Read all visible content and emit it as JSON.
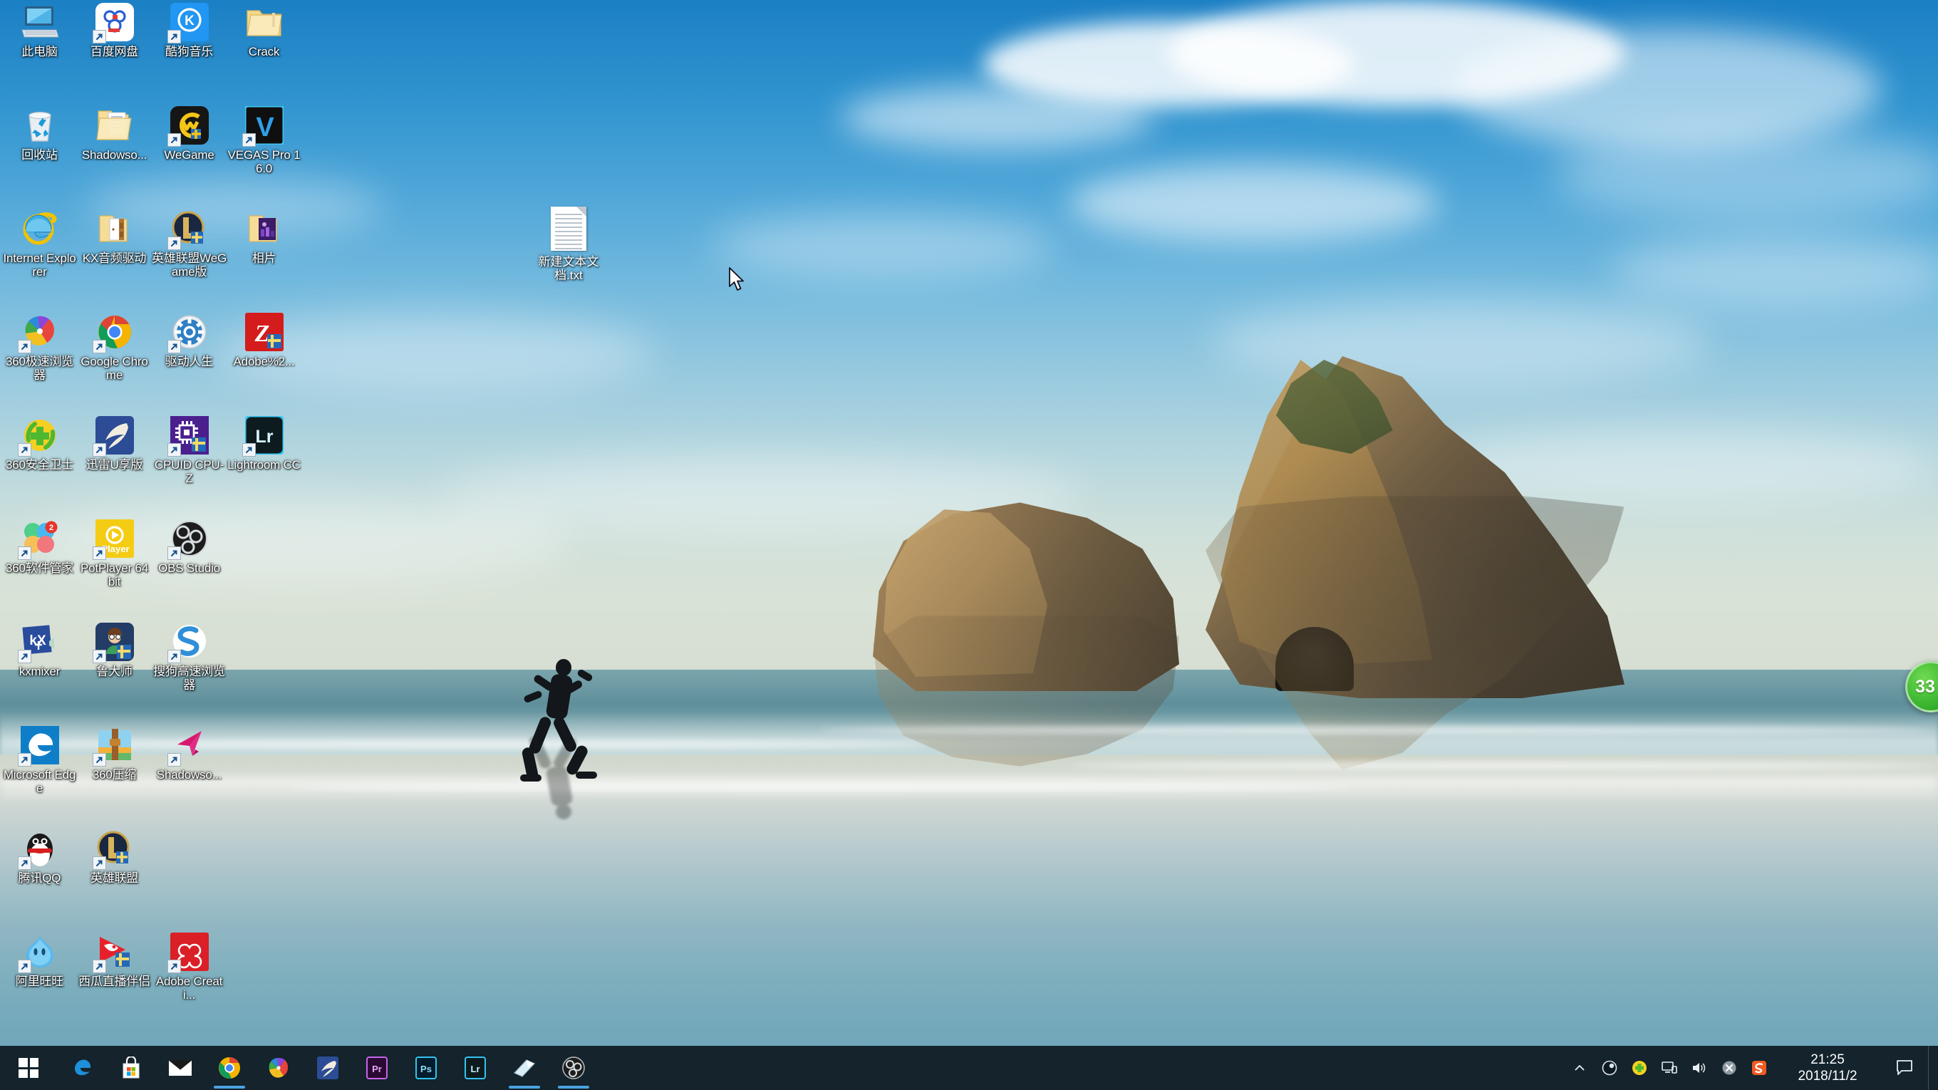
{
  "desktop": {
    "wallpaper_description": "Windows 10 default beach scene with Wharariki Beach archway rocks and a running woman silhouette",
    "icons": [
      {
        "label": "此电脑",
        "icon": "this-pc-icon",
        "shortcut": false,
        "row": 0,
        "col": 0
      },
      {
        "label": "百度网盘",
        "icon": "baidu-netdisk-icon",
        "shortcut": true,
        "row": 0,
        "col": 1
      },
      {
        "label": "酷狗音乐",
        "icon": "kugou-music-icon",
        "shortcut": true,
        "row": 0,
        "col": 2
      },
      {
        "label": "Crack",
        "icon": "folder-icon",
        "shortcut": false,
        "row": 0,
        "col": 3
      },
      {
        "label": "回收站",
        "icon": "recycle-bin-icon",
        "shortcut": false,
        "row": 1,
        "col": 0
      },
      {
        "label": "Shadowso...",
        "icon": "folder-documents-icon",
        "shortcut": false,
        "row": 1,
        "col": 1
      },
      {
        "label": "WeGame",
        "icon": "wegame-icon",
        "shortcut": true,
        "row": 1,
        "col": 2
      },
      {
        "label": "VEGAS Pro 16.0",
        "icon": "vegas-pro-icon",
        "shortcut": true,
        "row": 1,
        "col": 3
      },
      {
        "label": "Internet Explorer",
        "icon": "internet-explorer-icon",
        "shortcut": false,
        "row": 2,
        "col": 0
      },
      {
        "label": "KX音频驱动",
        "icon": "open-folder-icon",
        "shortcut": false,
        "row": 2,
        "col": 1
      },
      {
        "label": "英雄联盟WeGame版",
        "icon": "lol-wegame-icon",
        "shortcut": true,
        "row": 2,
        "col": 2
      },
      {
        "label": "相片",
        "icon": "photos-folder-icon",
        "shortcut": false,
        "row": 2,
        "col": 3
      },
      {
        "label": "360极速浏览器",
        "icon": "360-chrome-browser-icon",
        "shortcut": true,
        "row": 3,
        "col": 0
      },
      {
        "label": "Google Chrome",
        "icon": "google-chrome-icon",
        "shortcut": true,
        "row": 3,
        "col": 1
      },
      {
        "label": "驱动人生",
        "icon": "drivethelife-icon",
        "shortcut": true,
        "row": 3,
        "col": 2
      },
      {
        "label": "Adobe%2...",
        "icon": "adobe-zii-icon",
        "shortcut": false,
        "row": 3,
        "col": 3
      },
      {
        "label": "360安全卫士",
        "icon": "360-safeguard-icon",
        "shortcut": true,
        "row": 4,
        "col": 0
      },
      {
        "label": "迅雷U享版",
        "icon": "thunder-xunlei-icon",
        "shortcut": true,
        "row": 4,
        "col": 1
      },
      {
        "label": "CPUID CPU-Z",
        "icon": "cpuz-icon",
        "shortcut": true,
        "row": 4,
        "col": 2
      },
      {
        "label": "Lightroom CC",
        "icon": "lightroom-cc-icon",
        "shortcut": true,
        "row": 4,
        "col": 3
      },
      {
        "label": "360软件管家",
        "icon": "360-software-manager-icon",
        "shortcut": true,
        "row": 5,
        "col": 0,
        "badge": "2"
      },
      {
        "label": "PotPlayer 64 bit",
        "icon": "potplayer-icon",
        "shortcut": true,
        "row": 5,
        "col": 1
      },
      {
        "label": "OBS Studio",
        "icon": "obs-studio-icon",
        "shortcut": true,
        "row": 5,
        "col": 2
      },
      {
        "label": "kxmixer",
        "icon": "kxmixer-icon",
        "shortcut": true,
        "row": 6,
        "col": 0
      },
      {
        "label": "鲁大师",
        "icon": "ludashi-icon",
        "shortcut": true,
        "row": 6,
        "col": 1
      },
      {
        "label": "搜狗高速浏览器",
        "icon": "sogou-browser-icon",
        "shortcut": true,
        "row": 6,
        "col": 2
      },
      {
        "label": "Microsoft Edge",
        "icon": "microsoft-edge-icon",
        "shortcut": true,
        "row": 7,
        "col": 0
      },
      {
        "label": "360压缩",
        "icon": "360-zip-icon",
        "shortcut": true,
        "row": 7,
        "col": 1
      },
      {
        "label": "Shadowso...",
        "icon": "shadowsocks-icon",
        "shortcut": true,
        "row": 7,
        "col": 2
      },
      {
        "label": "腾讯QQ",
        "icon": "tencent-qq-icon",
        "shortcut": true,
        "row": 8,
        "col": 0
      },
      {
        "label": "英雄联盟",
        "icon": "league-of-legends-icon",
        "shortcut": true,
        "row": 8,
        "col": 1
      },
      {
        "label": "阿里旺旺",
        "icon": "aliwangwang-icon",
        "shortcut": true,
        "row": 9,
        "col": 0
      },
      {
        "label": "西瓜直播伴侣",
        "icon": "xigua-live-icon",
        "shortcut": true,
        "row": 9,
        "col": 1
      },
      {
        "label": "Adobe Creati...",
        "icon": "adobe-creative-cloud-icon",
        "shortcut": true,
        "row": 9,
        "col": 2
      }
    ],
    "loose_file": {
      "label": "新建文本文档.txt",
      "icon": "text-document-icon"
    },
    "edge_widget": {
      "value": "33",
      "icon": "green-circle-gauge-icon"
    }
  },
  "taskbar": {
    "start_label": "开始",
    "start_icon": "windows-logo-icon",
    "apps": [
      {
        "name": "Microsoft Edge",
        "icon": "microsoft-edge-icon",
        "running": false
      },
      {
        "name": "Microsoft Store",
        "icon": "microsoft-store-icon",
        "running": false
      },
      {
        "name": "邮件",
        "icon": "mail-icon",
        "running": false
      },
      {
        "name": "Google Chrome",
        "icon": "google-chrome-icon",
        "running": true
      },
      {
        "name": "360极速浏览器",
        "icon": "360-chrome-browser-icon",
        "running": false
      },
      {
        "name": "迅雷U享版",
        "icon": "thunder-xunlei-icon",
        "running": false
      },
      {
        "name": "Adobe Premiere Pro",
        "icon": "premiere-pro-icon",
        "running": false
      },
      {
        "name": "Adobe Photoshop",
        "icon": "photoshop-icon",
        "running": false
      },
      {
        "name": "Adobe Lightroom",
        "icon": "lightroom-icon",
        "running": false
      },
      {
        "name": "截图工具",
        "icon": "snipping-tool-icon",
        "running": true
      },
      {
        "name": "OBS Studio",
        "icon": "obs-studio-icon",
        "running": true
      }
    ],
    "tray": {
      "overflow_icon": "chevron-up-icon",
      "icons": [
        {
          "name": "SteelSeries Engine",
          "icon": "steelseries-icon"
        },
        {
          "name": "360安全卫士",
          "icon": "360-safeguard-tray-icon"
        },
        {
          "name": "网络",
          "icon": "network-icon"
        },
        {
          "name": "扬声器",
          "icon": "volume-icon"
        },
        {
          "name": "OneDrive 未登录",
          "icon": "onedrive-error-icon"
        },
        {
          "name": "搜狗输入法",
          "icon": "sogou-ime-icon"
        }
      ],
      "clock": {
        "time": "21:25",
        "date": "2018/11/2"
      },
      "action_center_icon": "action-center-icon",
      "show_desktop_label": "显示桌面"
    }
  },
  "colors": {
    "taskbar_bg": "#14232c",
    "accent": "#4aa3e0",
    "sky_top": "#1b7fc4",
    "sand": "#cfd7cd"
  }
}
